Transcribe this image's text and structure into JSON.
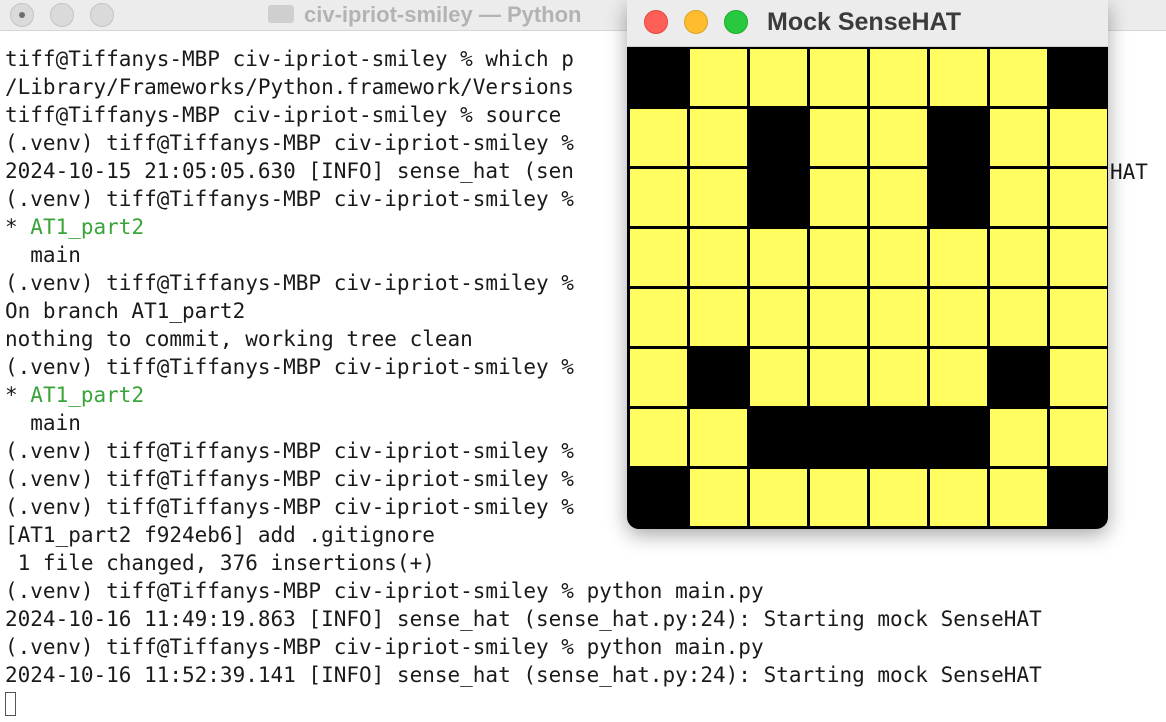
{
  "terminal": {
    "title": "civ-ipriot-smiley — Python",
    "lines": [
      "tiff@Tiffanys-MBP civ-ipriot-smiley % which p",
      "/Library/Frameworks/Python.framework/Versions",
      "tiff@Tiffanys-MBP civ-ipriot-smiley % source",
      "(.venv) tiff@Tiffanys-MBP civ-ipriot-smiley %",
      "2024-10-15 21:05:05.630 [INFO] sense_hat (sen",
      "(.venv) tiff@Tiffanys-MBP civ-ipriot-smiley %",
      "* AT1_part2",
      "  main",
      "(.venv) tiff@Tiffanys-MBP civ-ipriot-smiley %",
      "On branch AT1_part2",
      "nothing to commit, working tree clean",
      "(.venv) tiff@Tiffanys-MBP civ-ipriot-smiley %",
      "* AT1_part2",
      "  main",
      "(.venv) tiff@Tiffanys-MBP civ-ipriot-smiley %",
      "(.venv) tiff@Tiffanys-MBP civ-ipriot-smiley %",
      "(.venv) tiff@Tiffanys-MBP civ-ipriot-smiley %",
      "[AT1_part2 f924eb6] add .gitignore",
      " 1 file changed, 376 insertions(+)",
      "(.venv) tiff@Tiffanys-MBP civ-ipriot-smiley % python main.py",
      "2024-10-16 11:49:19.863 [INFO] sense_hat (sense_hat.py:24): Starting mock SenseHAT",
      "(.venv) tiff@Tiffanys-MBP civ-ipriot-smiley % python main.py",
      "2024-10-16 11:52:39.141 [INFO] sense_hat (sense_hat.py:24): Starting mock SenseHAT"
    ],
    "overflow_right_text": "HAT",
    "git_current_branch": "AT1_part2",
    "colors": {
      "text": "#1a1a1a",
      "git_current_branch": "#3aa43a"
    }
  },
  "sensehat": {
    "title": "Mock SenseHAT",
    "colors": {
      "Y": "#fffd60",
      "K": "#000000",
      "border": "#000000"
    },
    "pixels": [
      "KYYYYYYK",
      "YYKYYKYY",
      "YYKYYKYY",
      "YYYYYYYY",
      "YYYYYYYY",
      "YKYYYYKY",
      "YYKKKKYY",
      "KYYYYYYK"
    ]
  }
}
